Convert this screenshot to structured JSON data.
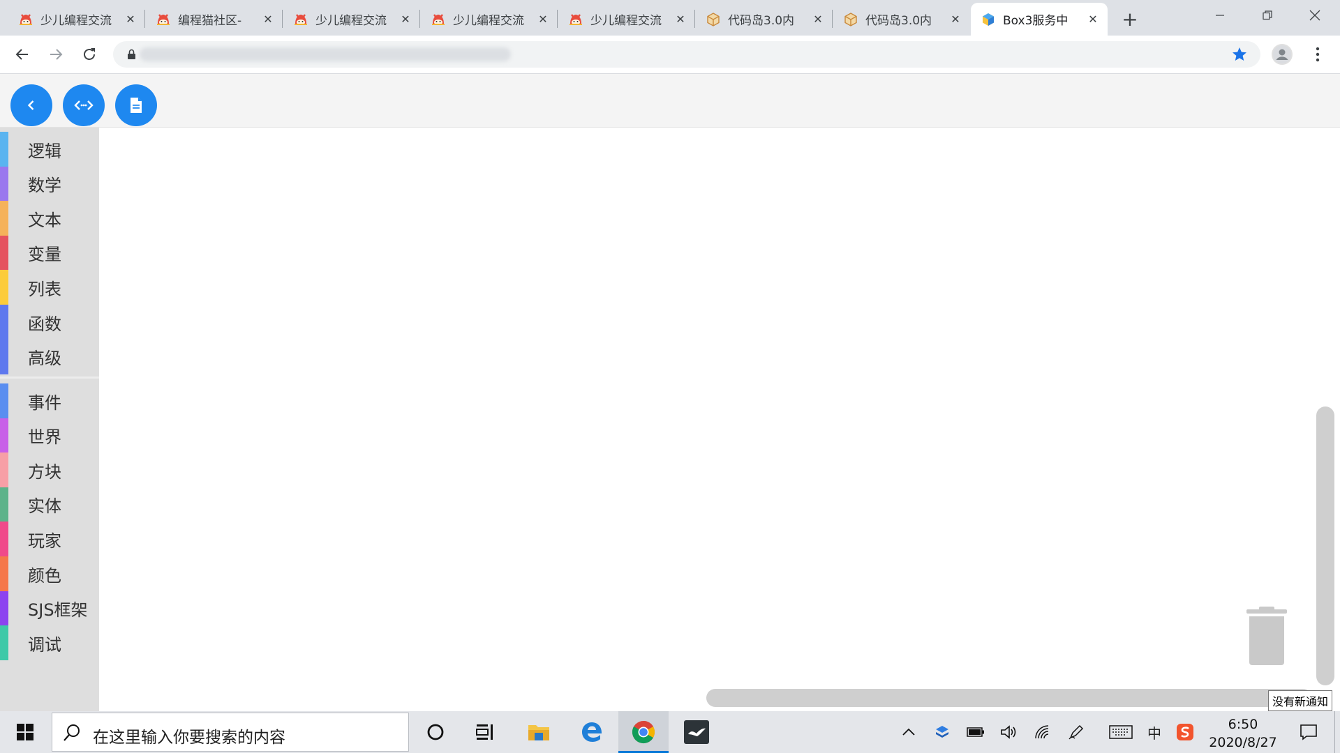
{
  "browser": {
    "tabs": [
      {
        "title": "少儿编程交流",
        "favicon": "cat-mascot-icon"
      },
      {
        "title": "编程猫社区-",
        "favicon": "cat-mascot-icon"
      },
      {
        "title": "少儿编程交流",
        "favicon": "cat-mascot-icon"
      },
      {
        "title": "少儿编程交流",
        "favicon": "cat-mascot-icon"
      },
      {
        "title": "少儿编程交流",
        "favicon": "cat-mascot-icon"
      },
      {
        "title": "代码岛3.0内",
        "favicon": "box-cube-icon"
      },
      {
        "title": "代码岛3.0内",
        "favicon": "box-cube-icon"
      },
      {
        "title": "Box3服务中",
        "favicon": "box3-icon",
        "active": true
      }
    ],
    "close_glyph": "✕",
    "new_tab_glyph": "+",
    "address": "",
    "accent": "#1a73e8"
  },
  "app": {
    "toolbar_button_color": "#1e88f0",
    "categories": [
      {
        "label": "逻辑",
        "color": "#5ab4f0"
      },
      {
        "label": "数学",
        "color": "#9a77ee"
      },
      {
        "label": "文本",
        "color": "#f5b25a"
      },
      {
        "label": "变量",
        "color": "#e5535f"
      },
      {
        "label": "列表",
        "color": "#fccc3a"
      },
      {
        "label": "函数",
        "color": "#5e78ee"
      },
      {
        "label": "高级",
        "color": "#5e78ee"
      }
    ],
    "game_categories": [
      {
        "label": "事件",
        "color": "#5a8ef0"
      },
      {
        "label": "世界",
        "color": "#c860e8"
      },
      {
        "label": "方块",
        "color": "#f79fa6"
      },
      {
        "label": "实体",
        "color": "#5cb38a"
      },
      {
        "label": "玩家",
        "color": "#f0498a"
      },
      {
        "label": "颜色",
        "color": "#f5774a"
      },
      {
        "label": "SJS框架",
        "color": "#8c43f0"
      },
      {
        "label": "调试",
        "color": "#3ec9a8"
      }
    ],
    "tooltip": "没有新通知"
  },
  "taskbar": {
    "search_placeholder": "在这里输入你要搜索的内容",
    "ime_label": "中",
    "time": "6:50",
    "date": "2020/8/27"
  }
}
